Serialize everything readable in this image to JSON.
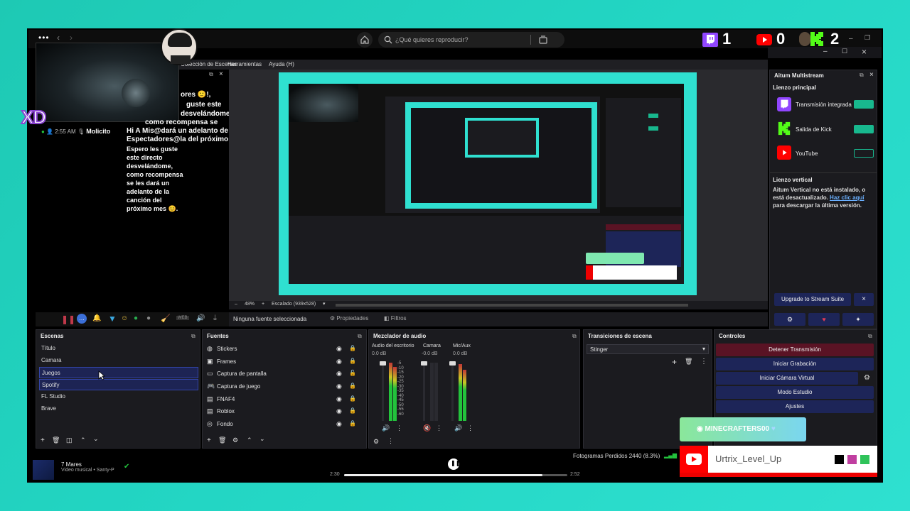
{
  "topbar": {
    "search_placeholder": "¿Qué quieres reproducir?",
    "twitch_count": "1",
    "youtube_count": "0",
    "kick_count": "2"
  },
  "overlay": {
    "xd": "XD"
  },
  "menu": {
    "items": [
      "Colección de Escenas",
      "Herramientas",
      "Ayuda (H)"
    ]
  },
  "chat": {
    "time": "2:55 AM",
    "user": "Molicito",
    "msg_right_a": "ores 🙂!,",
    "msg_right_b": "guste este",
    "msg_right_c": "desvelándome,",
    "msg_right_d": "como recompensa se",
    "msg_right_e": "Hi A Mis@dará un adelanto de",
    "msg_right_f": "Espectadores@la del próximo",
    "msg_left": [
      "Espero les guste",
      "este directo",
      "desvelándome,",
      "como recompensa",
      "se les dará un",
      "adelanto de la",
      "canción del",
      "próximo mes 😊."
    ]
  },
  "preview": {
    "zoom": "48%",
    "scale": "Escalado (939x528)",
    "no_source": "Ninguna fuente seleccionada",
    "properties": "Propiedades",
    "filters": "Filtros"
  },
  "multistream": {
    "title": "Aitum Multistream",
    "main_canvas": "Lienzo principal",
    "outputs": [
      "Transmisión integrada",
      "Salida de Kick",
      "YouTube"
    ],
    "vertical_title": "Lienzo vertical",
    "vertical_msg": "Aitum Vertical no está instalado, o está desactualizado.",
    "vertical_link": "Haz clic aquí",
    "vertical_link_rest": " para descargar la última versión.",
    "upgrade": "Upgrade to Stream Suite",
    "close_x": "×"
  },
  "scenes": {
    "title": "Escenas",
    "items": [
      "Título",
      "Camara",
      "Juegos",
      "Spotify",
      "FL Studio",
      "Brave"
    ]
  },
  "sources": {
    "title": "Fuentes",
    "items": [
      "Stickers",
      "Frames",
      "Captura de pantalla",
      "Captura de juego",
      "FNAF4",
      "Roblox",
      "Fondo"
    ]
  },
  "mixer": {
    "title": "Mezclador de audio",
    "channels": [
      {
        "name": "Audio del escritorio",
        "db": "0.0 dB"
      },
      {
        "name": "Camara",
        "db": "-0.0 dB"
      },
      {
        "name": "Mic/Aux",
        "db": "0.0 dB"
      }
    ],
    "scale": [
      "-5",
      "-10",
      "-15",
      "-20",
      "-25",
      "-30",
      "-35",
      "-40",
      "-45",
      "-50",
      "-55",
      "-60"
    ]
  },
  "transitions": {
    "title": "Transiciones de escena",
    "selected": "Stinger"
  },
  "controls": {
    "title": "Controles",
    "buttons": [
      "Detener Transmisión",
      "Iniciar Grabación",
      "Iniciar Cámara Virtual",
      "Modo Estudio",
      "Ajustes"
    ]
  },
  "statusbar": {
    "frames_lost": "Fotogramas Perdidos 2440 (8.3%)"
  },
  "player": {
    "song": "7 Mares",
    "artist": "Video musical • Santy-P",
    "elapsed": "2:30",
    "total": "2:52"
  },
  "badges": {
    "minecraft": "MINECRAFTERS00",
    "youtube_user": "Urtrix_Level_Up"
  },
  "colors": {
    "twitch": "#9146ff",
    "kick": "#53fc18",
    "youtube": "#ff0000",
    "stop_stream": "#5a1324",
    "control_btn": "#1d2558",
    "accent_teal": "#22d4c2"
  }
}
